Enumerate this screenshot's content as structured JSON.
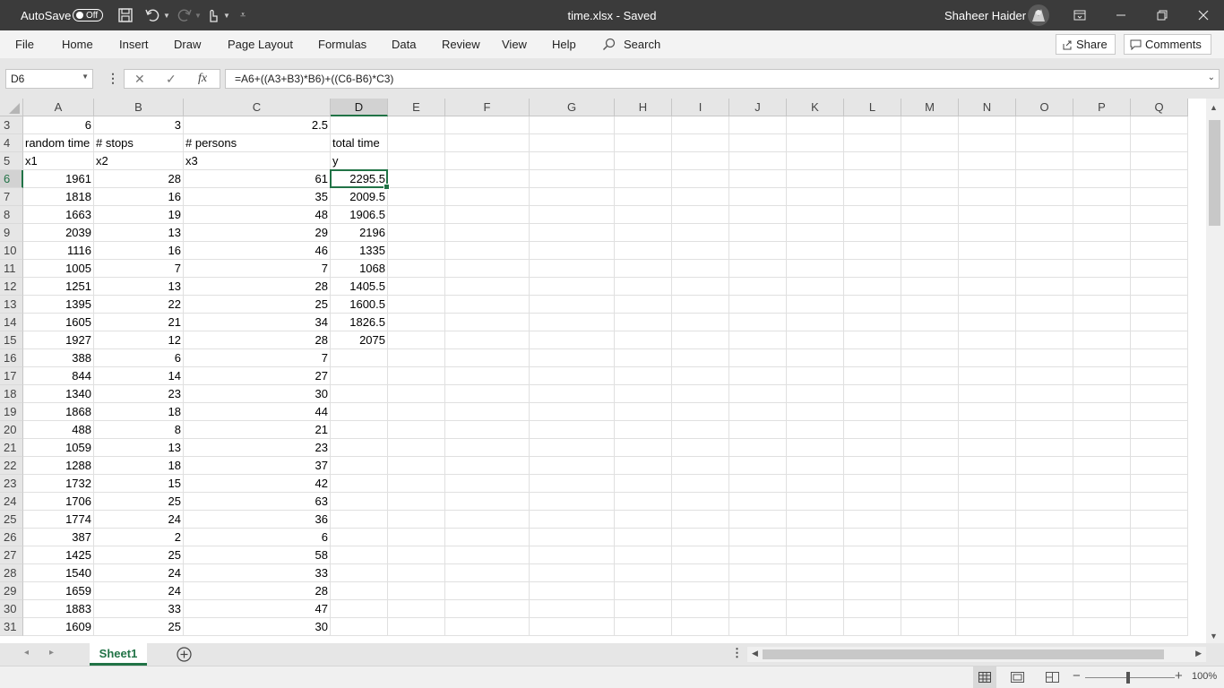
{
  "titlebar": {
    "autosave_label": "AutoSave",
    "autosave_state": "Off",
    "document_title": "time.xlsx  -  Saved",
    "user_name": "Shaheer Haider"
  },
  "ribbon": {
    "tabs": [
      "File",
      "Home",
      "Insert",
      "Draw",
      "Page Layout",
      "Formulas",
      "Data",
      "Review",
      "View",
      "Help"
    ],
    "search_label": "Search",
    "share_label": "Share",
    "comments_label": "Comments"
  },
  "formula_bar": {
    "name_box": "D6",
    "formula": "=A6+((A3+B3)*B6)+((C6-B6)*C3)"
  },
  "sheet": {
    "columns": [
      "A",
      "B",
      "C",
      "D",
      "E",
      "F",
      "G",
      "H",
      "I",
      "J",
      "K",
      "L",
      "M",
      "N",
      "O",
      "P",
      "Q"
    ],
    "selected_cell": "D6",
    "rows": [
      {
        "n": "3",
        "A": "6",
        "B": "3",
        "C": "2.5",
        "D": ""
      },
      {
        "n": "4",
        "A": "random time",
        "B": "# stops",
        "C": "# persons",
        "D": "total time"
      },
      {
        "n": "5",
        "A": "x1",
        "B": "x2",
        "C": "x3",
        "D": "y"
      },
      {
        "n": "6",
        "A": "1961",
        "B": "28",
        "C": "61",
        "D": "2295.5"
      },
      {
        "n": "7",
        "A": "1818",
        "B": "16",
        "C": "35",
        "D": "2009.5"
      },
      {
        "n": "8",
        "A": "1663",
        "B": "19",
        "C": "48",
        "D": "1906.5"
      },
      {
        "n": "9",
        "A": "2039",
        "B": "13",
        "C": "29",
        "D": "2196"
      },
      {
        "n": "10",
        "A": "1116",
        "B": "16",
        "C": "46",
        "D": "1335"
      },
      {
        "n": "11",
        "A": "1005",
        "B": "7",
        "C": "7",
        "D": "1068"
      },
      {
        "n": "12",
        "A": "1251",
        "B": "13",
        "C": "28",
        "D": "1405.5"
      },
      {
        "n": "13",
        "A": "1395",
        "B": "22",
        "C": "25",
        "D": "1600.5"
      },
      {
        "n": "14",
        "A": "1605",
        "B": "21",
        "C": "34",
        "D": "1826.5"
      },
      {
        "n": "15",
        "A": "1927",
        "B": "12",
        "C": "28",
        "D": "2075"
      },
      {
        "n": "16",
        "A": "388",
        "B": "6",
        "C": "7",
        "D": ""
      },
      {
        "n": "17",
        "A": "844",
        "B": "14",
        "C": "27",
        "D": ""
      },
      {
        "n": "18",
        "A": "1340",
        "B": "23",
        "C": "30",
        "D": ""
      },
      {
        "n": "19",
        "A": "1868",
        "B": "18",
        "C": "44",
        "D": ""
      },
      {
        "n": "20",
        "A": "488",
        "B": "8",
        "C": "21",
        "D": ""
      },
      {
        "n": "21",
        "A": "1059",
        "B": "13",
        "C": "23",
        "D": ""
      },
      {
        "n": "22",
        "A": "1288",
        "B": "18",
        "C": "37",
        "D": ""
      },
      {
        "n": "23",
        "A": "1732",
        "B": "15",
        "C": "42",
        "D": ""
      },
      {
        "n": "24",
        "A": "1706",
        "B": "25",
        "C": "63",
        "D": ""
      },
      {
        "n": "25",
        "A": "1774",
        "B": "24",
        "C": "36",
        "D": ""
      },
      {
        "n": "26",
        "A": "387",
        "B": "2",
        "C": "6",
        "D": ""
      },
      {
        "n": "27",
        "A": "1425",
        "B": "25",
        "C": "58",
        "D": ""
      },
      {
        "n": "28",
        "A": "1540",
        "B": "24",
        "C": "33",
        "D": ""
      },
      {
        "n": "29",
        "A": "1659",
        "B": "24",
        "C": "28",
        "D": ""
      },
      {
        "n": "30",
        "A": "1883",
        "B": "33",
        "C": "47",
        "D": ""
      },
      {
        "n": "31",
        "A": "1609",
        "B": "25",
        "C": "30",
        "D": ""
      }
    ]
  },
  "sheet_tabs": [
    "Sheet1"
  ],
  "status": {
    "zoom": "100%"
  },
  "colors": {
    "accent": "#217346",
    "titlebar": "#3b3b3b"
  }
}
